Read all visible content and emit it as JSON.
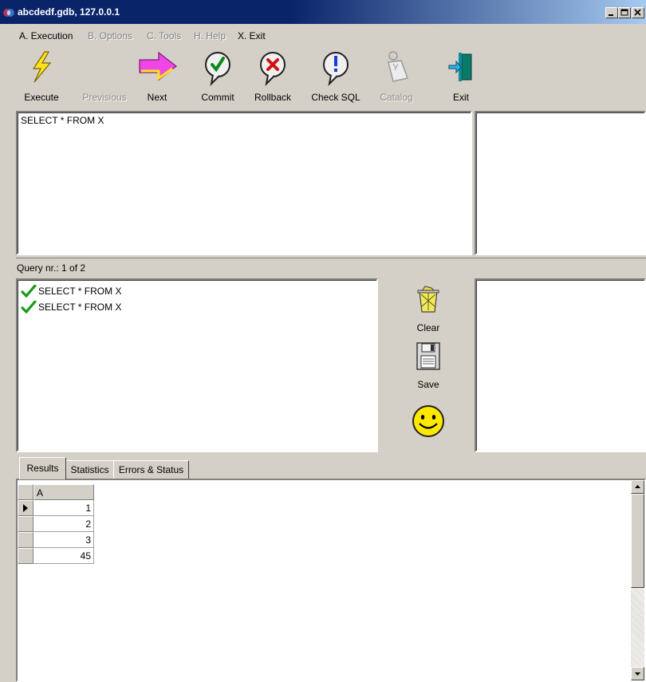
{
  "window": {
    "title": "abcdedf.gdb, 127.0.0.1",
    "controls": [
      "minimize",
      "maximize",
      "close"
    ]
  },
  "menu": [
    {
      "label": "A. Execution",
      "enabled": true
    },
    {
      "label": "B. Options",
      "enabled": false
    },
    {
      "label": "C. Tools",
      "enabled": false
    },
    {
      "label": "H. Help",
      "enabled": false
    },
    {
      "label": "X. Exit",
      "enabled": true
    }
  ],
  "toolbar": [
    {
      "label": "Execute",
      "icon": "lightning-icon",
      "enabled": true
    },
    {
      "label": "Previsious",
      "icon": "arrow-left-icon",
      "enabled": false
    },
    {
      "label": "Next",
      "icon": "arrow-right-icon",
      "enabled": true
    },
    {
      "label": "Commit",
      "icon": "check-bubble-icon",
      "enabled": true
    },
    {
      "label": "Rollback",
      "icon": "x-bubble-icon",
      "enabled": true
    },
    {
      "label": "Check SQL",
      "icon": "exclamation-bubble-icon",
      "enabled": true
    },
    {
      "label": "Catalog",
      "icon": "catalog-icon",
      "enabled": false
    },
    {
      "label": "Exit",
      "icon": "exit-door-icon",
      "enabled": true
    }
  ],
  "editor": {
    "text": "SELECT * FROM X"
  },
  "query_status": "Query nr.: 1 of 2",
  "history": [
    {
      "status": "ok",
      "text": "SELECT * FROM X"
    },
    {
      "status": "ok",
      "text": "SELECT * FROM X"
    }
  ],
  "side_buttons": [
    {
      "label": "Clear",
      "icon": "trash-can-icon"
    },
    {
      "label": "Save",
      "icon": "floppy-disk-icon"
    },
    {
      "label": "",
      "icon": "smiley-icon"
    }
  ],
  "tabs": [
    {
      "label": "Results",
      "active": true
    },
    {
      "label": "Statistics",
      "active": false
    },
    {
      "label": "Errors & Status",
      "active": false
    }
  ],
  "results": {
    "columns": [
      "A"
    ],
    "rows": [
      [
        "1"
      ],
      [
        "2"
      ],
      [
        "3"
      ],
      [
        "45"
      ]
    ],
    "current_row": 0
  },
  "colors": {
    "titlebar_start": "#0a246a",
    "titlebar_end": "#a6caf0",
    "face": "#d4d0c8",
    "check_green": "#1a9a1a"
  }
}
